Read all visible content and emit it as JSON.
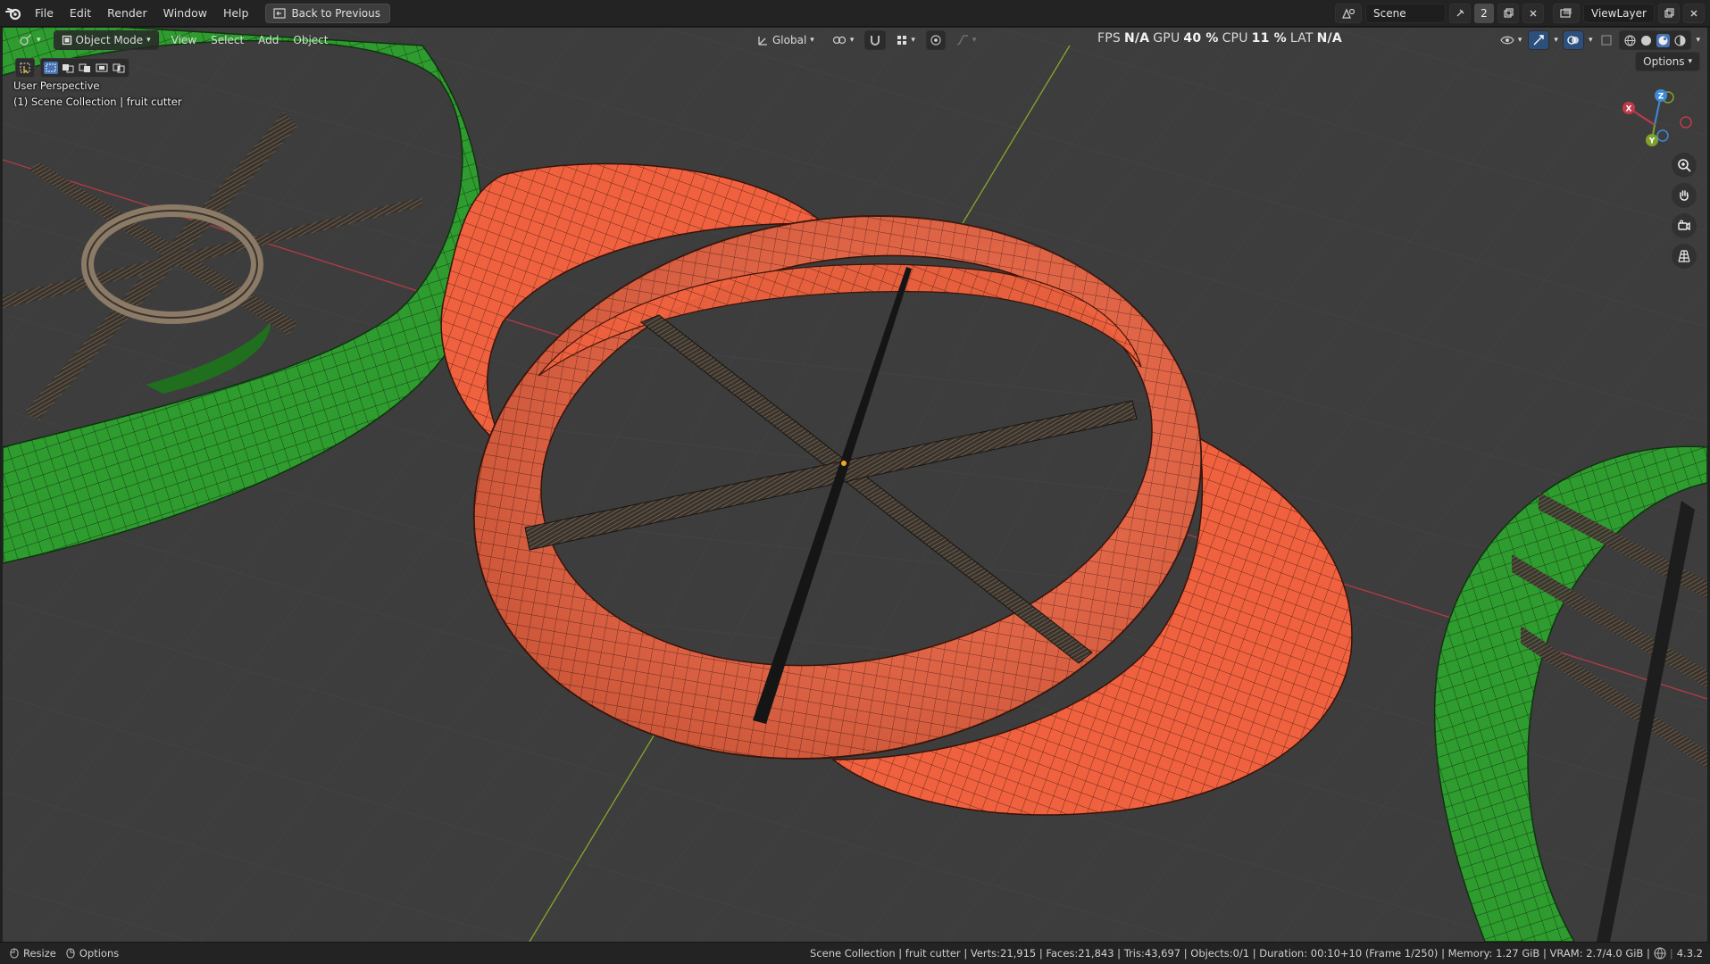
{
  "menu": {
    "items": [
      "File",
      "Edit",
      "Render",
      "Window",
      "Help"
    ],
    "back_button": "Back to Previous"
  },
  "top_right": {
    "scene_name": "Scene",
    "scene_users": "2",
    "view_layer": "ViewLayer"
  },
  "viewport_header": {
    "mode": "Object Mode",
    "menus": [
      "View",
      "Select",
      "Add",
      "Object"
    ],
    "orientation": "Global",
    "options_label": "Options"
  },
  "stats_overlay": {
    "fps_label": "FPS",
    "fps_value": "N/A",
    "gpu_label": "GPU",
    "gpu_value": "40 %",
    "cpu_label": "CPU",
    "cpu_value": "11 %",
    "lat_label": "LAT",
    "lat_value": "N/A"
  },
  "viewport_info": {
    "perspective": "User Perspective",
    "collection": "(1) Scene Collection | fruit cutter"
  },
  "gizmo": {
    "x": "X",
    "y": "Y",
    "z": "Z"
  },
  "statusbar": {
    "left": [
      "Resize",
      "Options"
    ],
    "stats": "Scene Collection | fruit cutter | Verts:21,915 | Faces:21,843 | Tris:43,697 | Objects:0/1 | Duration: 00:10+10 (Frame 1/250) | Memory: 1.27 GiB | VRAM: 2.7/4.0 GiB |",
    "version": "4.3.2"
  },
  "colors": {
    "viewport_bg": "#3d3d3d",
    "selected_object": "#f0623f",
    "other_objects": "#2f9c2f",
    "axis_x": "#c23a4a",
    "axis_y": "#7fa12a"
  }
}
